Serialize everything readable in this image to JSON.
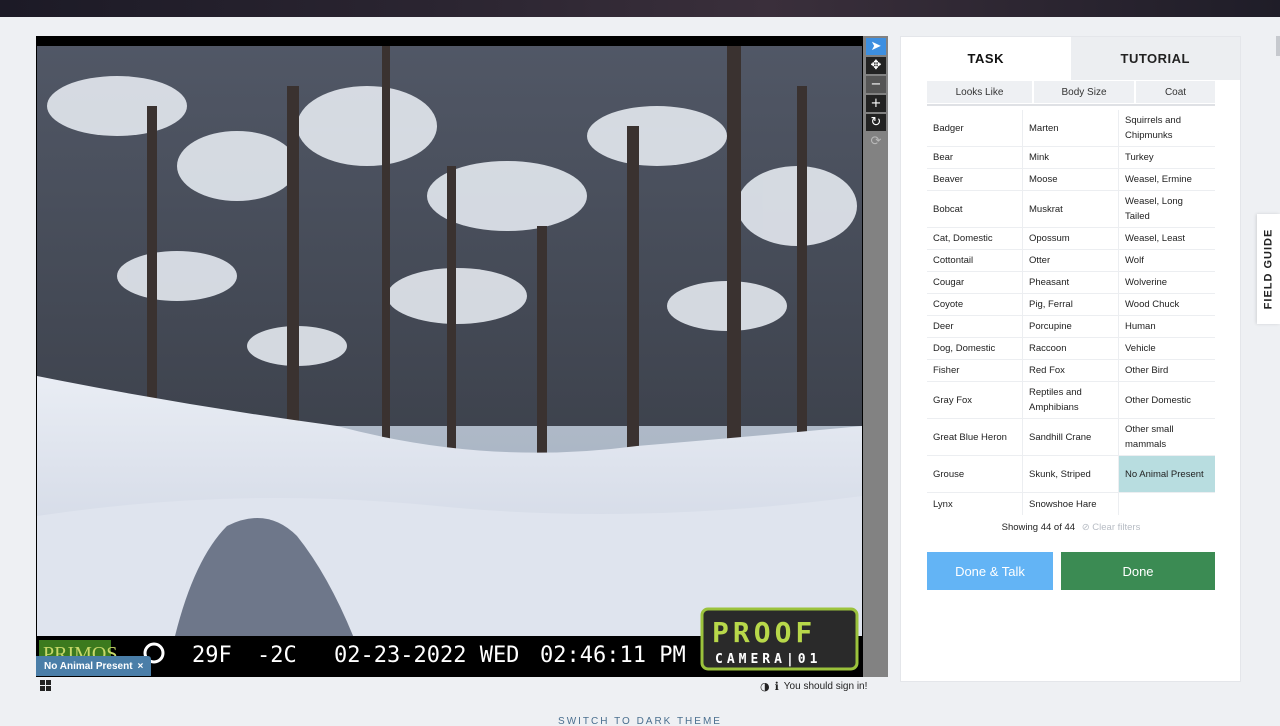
{
  "viewer": {
    "overlay": {
      "brand_left": "PRIMOS",
      "temp_f": "29F",
      "temp_c": "-2C",
      "date": "02-23-2022 WED",
      "time": "02:46:11 PM",
      "brand_right_top": "PROOF",
      "brand_right_bottom": "CAMERA|01"
    },
    "tools": [
      {
        "name": "pointer-tool",
        "icon": "arrow-pointer-icon",
        "glyph": "➤"
      },
      {
        "name": "move-tool",
        "icon": "move-arrows-icon",
        "glyph": "✥"
      },
      {
        "name": "zoom-out-tool",
        "icon": "minus-icon",
        "glyph": "−"
      },
      {
        "name": "zoom-in-tool",
        "icon": "plus-icon",
        "glyph": "+"
      },
      {
        "name": "rotate-tool",
        "icon": "rotate-icon",
        "glyph": "↻"
      },
      {
        "name": "reset-tool",
        "icon": "reset-icon",
        "glyph": "⟳"
      }
    ],
    "subject_tag": "No Animal Present",
    "subject_tag_close": "×",
    "signin_text": "You should sign in!"
  },
  "panel": {
    "tabs": {
      "task": "TASK",
      "tutorial": "TUTORIAL"
    },
    "filters": [
      "Looks Like",
      "Body Size",
      "Coat"
    ],
    "choices": [
      [
        "Badger",
        "Marten",
        "Squirrels and Chipmunks"
      ],
      [
        "Bear",
        "Mink",
        "Turkey"
      ],
      [
        "Beaver",
        "Moose",
        "Weasel, Ermine"
      ],
      [
        "Bobcat",
        "Muskrat",
        "Weasel, Long Tailed"
      ],
      [
        "Cat, Domestic",
        "Opossum",
        "Weasel, Least"
      ],
      [
        "Cottontail",
        "Otter",
        "Wolf"
      ],
      [
        "Cougar",
        "Pheasant",
        "Wolverine"
      ],
      [
        "Coyote",
        "Pig, Ferral",
        "Wood Chuck"
      ],
      [
        "Deer",
        "Porcupine",
        "Human"
      ],
      [
        "Dog, Domestic",
        "Raccoon",
        "Vehicle"
      ],
      [
        "Fisher",
        "Red Fox",
        "Other Bird"
      ],
      [
        "Gray Fox",
        "Reptiles and Amphibians",
        "Other Domestic"
      ],
      [
        "Great Blue Heron",
        "Sandhill Crane",
        "Other small mammals"
      ],
      [
        "Grouse",
        "Skunk, Striped",
        "No Animal Present"
      ],
      [
        "Lynx",
        "Snowshoe Hare",
        ""
      ]
    ],
    "selected_choice": "No Animal Present",
    "showing": "Showing 44 of 44",
    "clear_filters": "⊘ Clear filters",
    "buttons": {
      "done_talk": "Done & Talk",
      "done": "Done"
    }
  },
  "field_guide": "FIELD GUIDE",
  "theme_switch": "SWITCH TO DARK THEME",
  "colors": {
    "accent_blue": "#63b4f5",
    "done_green": "#3b8b53",
    "selected_teal": "#b8dde0",
    "tag_blue": "#4a7ea8"
  }
}
